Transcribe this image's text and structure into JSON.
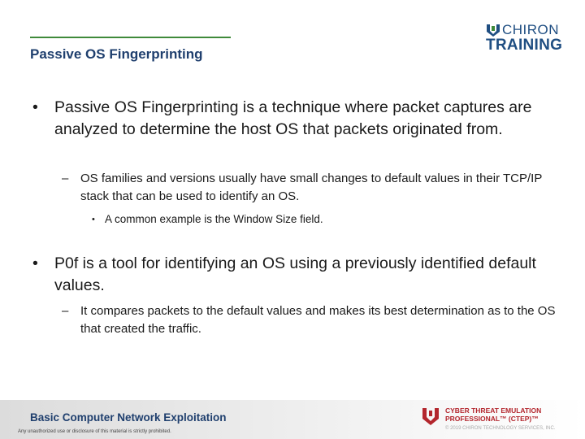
{
  "header": {
    "title": "Passive OS Fingerprinting",
    "logo": {
      "top": "CHIRON",
      "bottom": "TRAINING"
    }
  },
  "bullets": [
    {
      "text": "Passive OS Fingerprinting is a technique where packet captures are analyzed to determine the host OS that packets originated from.",
      "sub": [
        {
          "text": "OS families and versions usually have small changes to default values in their TCP/IP stack that can be used to identify an OS.",
          "sub": [
            {
              "text": "A common example is the Window Size field."
            }
          ]
        }
      ]
    },
    {
      "text": "P0f is a tool for identifying an OS using a previously identified default values.",
      "sub": [
        {
          "text": "It compares packets to the default values and makes its best determination as to the OS that created the traffic."
        }
      ]
    }
  ],
  "marks": {
    "level1": "•",
    "level2": "–",
    "level3": "•"
  },
  "footer": {
    "course": "Basic Computer Network Exploitation",
    "notice": "Any unauthorized use or disclosure of this material is strictly prohibited.",
    "program_line1": "CYBER THREAT EMULATION",
    "program_line2": "PROFESSIONAL™ (CTEP)™",
    "copyright": "© 2019 CHIRON TECHNOLOGY SERVICES, INC."
  },
  "colors": {
    "title": "#1f3f6e",
    "rule": "#3f8a3a",
    "logo": "#1f4e82",
    "ctep": "#b3262d"
  }
}
